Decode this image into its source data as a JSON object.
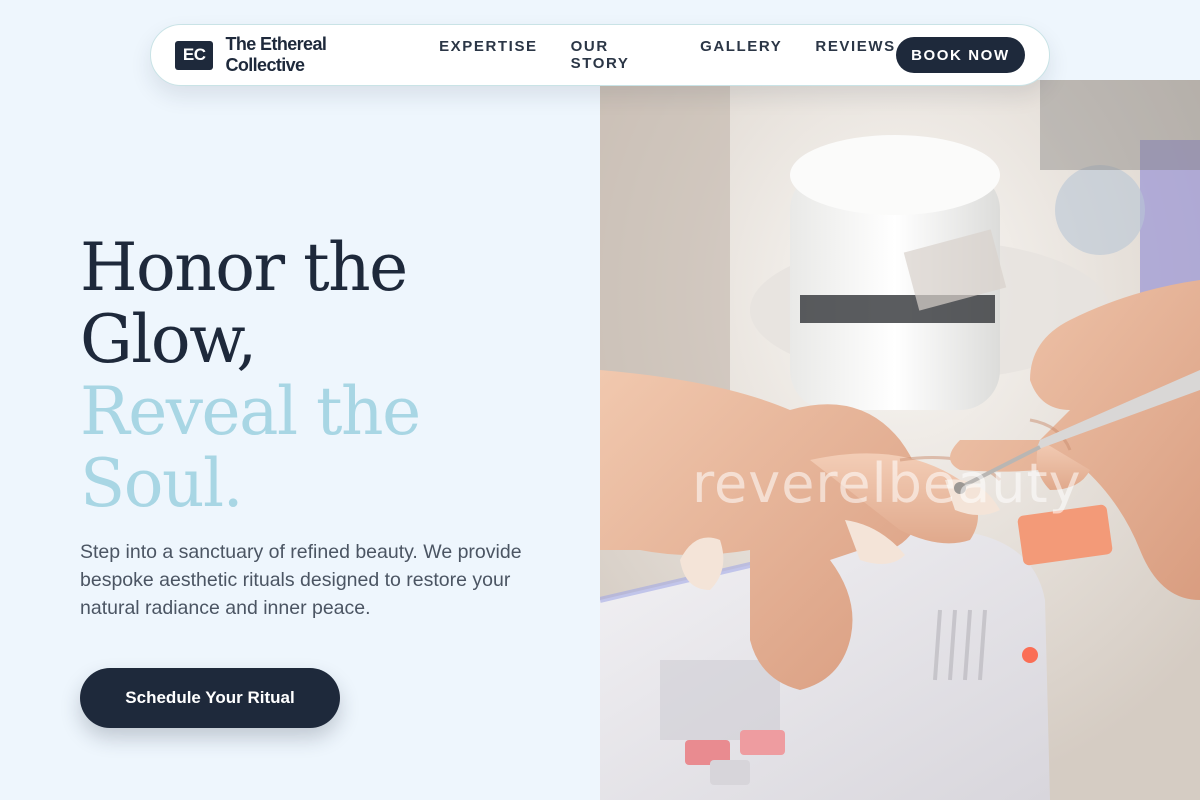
{
  "nav": {
    "brand_mark": "EC",
    "brand_name": "The Ethereal Collective",
    "links": [
      {
        "label": "EXPERTISE"
      },
      {
        "label": "OUR STORY"
      },
      {
        "label": "GALLERY"
      },
      {
        "label": "REVIEWS"
      }
    ],
    "cta_label": "BOOK NOW"
  },
  "hero": {
    "headline_dark_1": "Honor the",
    "headline_dark_2": "Glow,",
    "headline_light_1": "Reveal the",
    "headline_light_2": "Soul.",
    "subcopy": "Step into a sanctuary of refined beauty. We provide bespoke aesthetic rituals designed to restore your natural radiance and inner peace.",
    "cta_label": "Schedule Your Ritual",
    "image_watermark": "reverelbeauty"
  },
  "colors": {
    "page_bg": "#eef6fd",
    "primary_dark": "#1e293b",
    "accent_light_blue": "#a8d6e4",
    "body_text": "#4b5563"
  }
}
